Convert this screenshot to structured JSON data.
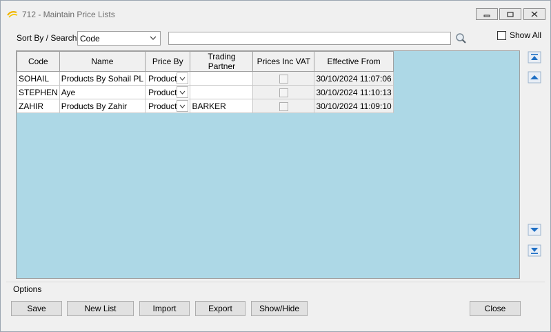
{
  "window": {
    "title": "712 - Maintain Price Lists"
  },
  "toolbar": {
    "sort_label": "Sort By / Search:",
    "sort_value": "Code",
    "search_value": "",
    "show_all_label": "Show All",
    "show_all_checked": false
  },
  "grid": {
    "columns": [
      "Code",
      "Name",
      "Price By",
      "Trading Partner",
      "Prices Inc VAT",
      "Effective From"
    ],
    "rows": [
      {
        "code": "SOHAIL",
        "name": "Products By Sohail PL",
        "price_by": "Product",
        "trading_partner": "",
        "prices_inc_vat": false,
        "effective_from": "30/10/2024 11:07:06"
      },
      {
        "code": "STEPHEN",
        "name": "Aye",
        "price_by": "Product",
        "trading_partner": "",
        "prices_inc_vat": false,
        "effective_from": "30/10/2024 11:10:13"
      },
      {
        "code": "ZAHIR",
        "name": "Products By Zahir",
        "price_by": "Product",
        "trading_partner": "BARKER",
        "prices_inc_vat": false,
        "effective_from": "30/10/2024 11:09:10"
      }
    ]
  },
  "options": {
    "label": "Options",
    "buttons": {
      "save": "Save",
      "new_list": "New List",
      "import": "Import",
      "export": "Export",
      "show_hide": "Show/Hide",
      "close": "Close"
    }
  },
  "colors": {
    "grid_background": "#add8e6",
    "accent": "#1e6fc4"
  }
}
